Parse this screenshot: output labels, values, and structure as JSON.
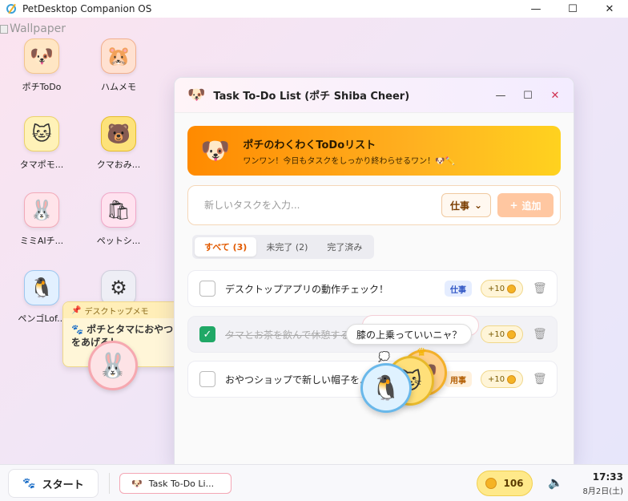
{
  "os": {
    "title": "PetDesktop Companion OS",
    "minimize": "—",
    "maximize": "☐",
    "close": "✕"
  },
  "wallpaper_alt": "Wallpaper",
  "desktop_icons": [
    {
      "label": "ポチToDo",
      "glyph": "🐶",
      "bg": "#ffe6c4",
      "border": "#f3c58c",
      "icon": "dog-icon"
    },
    {
      "label": "ハムメモ",
      "glyph": "🐹",
      "bg": "#ffe1d1",
      "border": "#f1b08f",
      "icon": "hamster-icon"
    },
    {
      "label": "タマポモ...",
      "glyph": "🐱",
      "bg": "#fff2b8",
      "border": "#ecd26a",
      "icon": "cat-icon"
    },
    {
      "label": "クマおみ...",
      "glyph": "🐻",
      "bg": "#fde27a",
      "border": "#e6bd2c",
      "icon": "bear-icon"
    },
    {
      "label": "ミミAIチ...",
      "glyph": "🐰",
      "bg": "#ffe4ea",
      "border": "#f3a9b8",
      "icon": "rabbit-icon"
    },
    {
      "label": "ペットシ...",
      "glyph": "🛍",
      "bg": "#ffe2ef",
      "border": "#f0a7c8",
      "icon": "shopping-bag-icon"
    },
    {
      "label": "ペンゴLof...",
      "glyph": "🐧",
      "bg": "#e2f0ff",
      "border": "#9cc8f0",
      "icon": "penguin-icon"
    },
    {
      "label": "",
      "glyph": "⚙",
      "bg": "#eeeef5",
      "border": "#cfcfdc",
      "icon": "gear-icon"
    }
  ],
  "memo": {
    "header": "デスクトップメモ",
    "body": "🐾 ポチとタマにおやつをあげる！"
  },
  "window": {
    "title": "Task To-Do List (ポチ Shiba Cheer)",
    "banner_title": "ポチのわくわくToDoリスト",
    "banner_subtitle": "ワンワン！今日もタスクをしっかり終わらせるワン！🐶✏️",
    "input_placeholder": "新しいタスクを入力...",
    "category_selected": "仕事",
    "add_label": "追加",
    "tabs": [
      {
        "label": "すべて (3)",
        "active": true
      },
      {
        "label": "未完了 (2)",
        "active": false
      },
      {
        "label": "完了済み",
        "active": false
      }
    ],
    "tasks": [
      {
        "text": "デスクトップアプリの動作チェック！",
        "tag": "仕事",
        "points": "+10",
        "done": false
      },
      {
        "text": "タマとお茶を飲んで休憩する",
        "tag": "",
        "points": "+10",
        "done": true
      },
      {
        "text": "おやつショップで新しい帽子を...",
        "tag": "用事",
        "points": "+10",
        "done": false
      }
    ]
  },
  "pet_bubble": "膝の上乗っていいニャ？",
  "taskbar": {
    "start_label": "スタート",
    "app_label": "Task To-Do Li...",
    "coins": "106",
    "time": "17:33",
    "date": "8月2日(土)"
  }
}
